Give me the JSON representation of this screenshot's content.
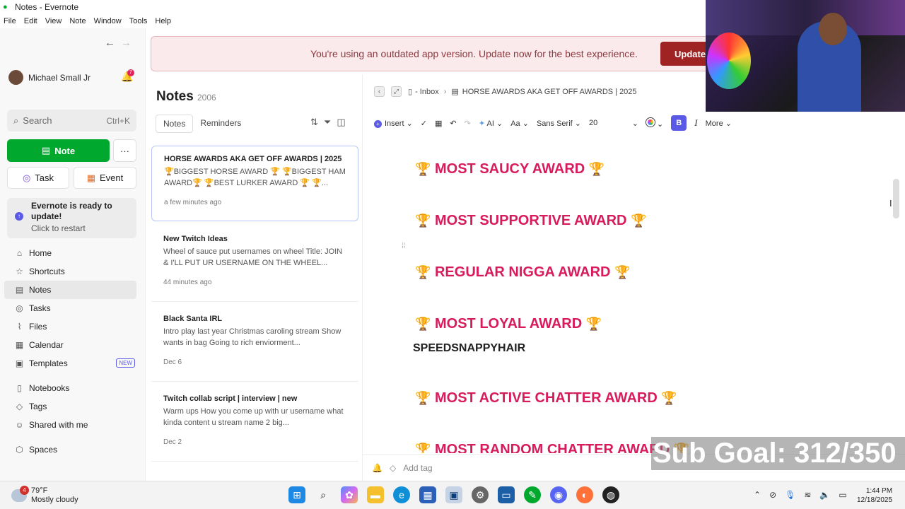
{
  "window": {
    "title": "Notes - Evernote"
  },
  "menu": [
    "File",
    "Edit",
    "View",
    "Note",
    "Window",
    "Tools",
    "Help"
  ],
  "sidebar": {
    "user_name": "Michael Small Jr",
    "notification_count": "7",
    "search_label": "Search",
    "search_shortcut": "Ctrl+K",
    "new_note_label": "Note",
    "task_label": "Task",
    "event_label": "Event",
    "update_title": "Evernote is ready to update!",
    "update_sub": "Click to restart",
    "nav": [
      {
        "label": "Home",
        "icon": "home-icon"
      },
      {
        "label": "Shortcuts",
        "icon": "star-icon"
      },
      {
        "label": "Notes",
        "icon": "note-icon"
      },
      {
        "label": "Tasks",
        "icon": "check-circle-icon"
      },
      {
        "label": "Files",
        "icon": "paperclip-icon"
      },
      {
        "label": "Calendar",
        "icon": "calendar-icon"
      },
      {
        "label": "Templates",
        "icon": "template-icon",
        "badge": "NEW"
      },
      {
        "label": "Notebooks",
        "icon": "notebook-icon"
      },
      {
        "label": "Tags",
        "icon": "tag-icon"
      },
      {
        "label": "Shared with me",
        "icon": "people-icon"
      },
      {
        "label": "Spaces",
        "icon": "spaces-icon"
      }
    ]
  },
  "banner": {
    "text": "You're using an outdated app version. Update now for the best experience.",
    "button": "Update"
  },
  "notelist": {
    "title": "Notes",
    "count": "2006",
    "tabs": [
      "Notes",
      "Reminders"
    ],
    "notes": [
      {
        "title": "HORSE AWARDS AKA GET OFF AWARDS | 2025",
        "preview": "🏆BIGGEST HORSE AWARD 🏆 🏆BIGGEST HAM AWARD🏆 🏆BEST LURKER AWARD 🏆 🏆...",
        "date": "a few minutes ago"
      },
      {
        "title": "New Twitch Ideas",
        "preview": "Wheel of sauce put usernames on wheel Title: JOIN & I'LL PUT UR USERNAME ON THE WHEEL...",
        "date": "44 minutes ago"
      },
      {
        "title": "Black Santa IRL",
        "preview": "Intro play last year Christmas caroling stream Show wants in bag Going to rich enviorment...",
        "date": "Dec 6"
      },
      {
        "title": "Twitch collab script | interview | new",
        "preview": "Warm ups How you come up with ur username what kinda content u stream name 2 big...",
        "date": "Dec 2"
      }
    ]
  },
  "editor": {
    "breadcrumb_notebook": "- Inbox",
    "breadcrumb_note": "HORSE AWARDS AKA GET OFF AWARDS | 2025",
    "toolbar": {
      "insert": "Insert",
      "ai": "AI",
      "text_style": "Aa",
      "font": "Sans Serif",
      "size": "20",
      "bold": "B",
      "italic": "I",
      "more": "More"
    },
    "awards": [
      "MOST SAUCY AWARD",
      "MOST SUPPORTIVE AWARD",
      "REGULAR NIGGA AWARD",
      "MOST LOYAL AWARD",
      "MOST ACTIVE CHATTER AWARD",
      "MOST RANDOM CHATTER AWARD"
    ],
    "trophy": "🏆",
    "typed_line": "SPEEDSNAPPYHAIR",
    "tag_placeholder": "Add tag"
  },
  "overlay": {
    "sub_goal": "Sub Goal: 312/350"
  },
  "taskbar": {
    "weather_badge": "4",
    "temperature": "79°F",
    "condition": "Mostly cloudy",
    "time": "1:44 PM",
    "date": "12/18/2025"
  }
}
